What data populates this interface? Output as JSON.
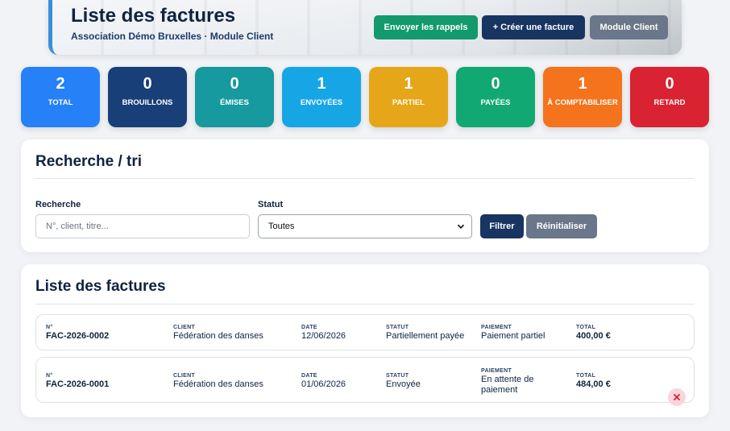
{
  "header": {
    "title": "Liste des factures",
    "subtitle": "Association Démo Bruxelles · Module Client",
    "buttons": {
      "reminders": "Envoyer les rappels",
      "create": "+ Créer une facture",
      "client_module": "Module Client"
    }
  },
  "stats": [
    {
      "value": "2",
      "label": "TOTAL",
      "color": "#2680f8"
    },
    {
      "value": "0",
      "label": "BROUILLONS",
      "color": "#183f78"
    },
    {
      "value": "0",
      "label": "ÉMISES",
      "color": "#16999f"
    },
    {
      "value": "1",
      "label": "ENVOYÉES",
      "color": "#16a6e6"
    },
    {
      "value": "1",
      "label": "PARTIEL",
      "color": "#e6a619"
    },
    {
      "value": "0",
      "label": "PAYÉES",
      "color": "#12a874"
    },
    {
      "value": "1",
      "label": "À COMPTABILISER",
      "color": "#f5731c"
    },
    {
      "value": "0",
      "label": "RETARD",
      "color": "#d92232"
    }
  ],
  "search": {
    "title": "Recherche / tri",
    "search_label": "Recherche",
    "search_placeholder": "N°, client, titre...",
    "status_label": "Statut",
    "status_value": "Toutes",
    "filter_button": "Filtrer",
    "reset_button": "Réinitialiser"
  },
  "list": {
    "title": "Liste des factures",
    "headers": {
      "number": "N°",
      "client": "CLIENT",
      "date": "DATE",
      "status": "STATUT",
      "payment": "PAIEMENT",
      "total": "TOTAL"
    },
    "rows": [
      {
        "number": "FAC-2026-0002",
        "client": "Fédération des danses",
        "date": "12/06/2026",
        "status": "Partiellement payée",
        "payment": "Paiement partiel",
        "total": "400,00 €"
      },
      {
        "number": "FAC-2026-0001",
        "client": "Fédération des danses",
        "date": "01/06/2026",
        "status": "Envoyée",
        "payment": "En attente de paiement",
        "total": "484,00 €"
      }
    ]
  }
}
